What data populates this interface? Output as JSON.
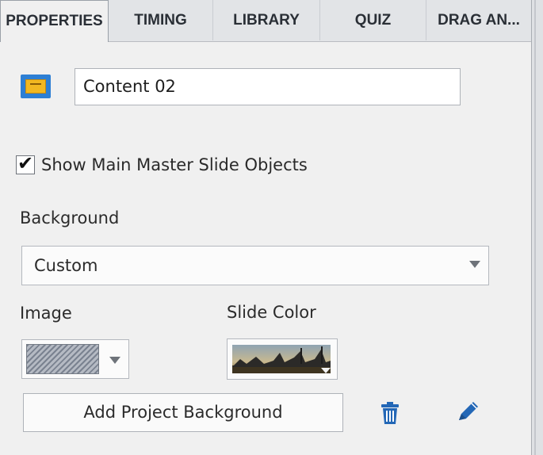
{
  "tabs": [
    {
      "label": "PROPERTIES",
      "active": true
    },
    {
      "label": "TIMING",
      "active": false
    },
    {
      "label": "LIBRARY",
      "active": false
    },
    {
      "label": "QUIZ",
      "active": false
    },
    {
      "label": "DRAG AN...",
      "active": false
    }
  ],
  "slide": {
    "icon": "slide-icon",
    "name": "Content 02"
  },
  "master": {
    "checked": true,
    "label": "Show Main Master Slide Objects"
  },
  "background": {
    "label": "Background",
    "selected": "Custom"
  },
  "image": {
    "label": "Image"
  },
  "slide_color": {
    "label": "Slide Color"
  },
  "actions": {
    "add_background_label": "Add Project Background",
    "delete_icon": "trash-icon",
    "edit_icon": "pencil-icon"
  },
  "colors": {
    "accent": "#2d7fd4",
    "icon_yellow": "#f2b821"
  }
}
